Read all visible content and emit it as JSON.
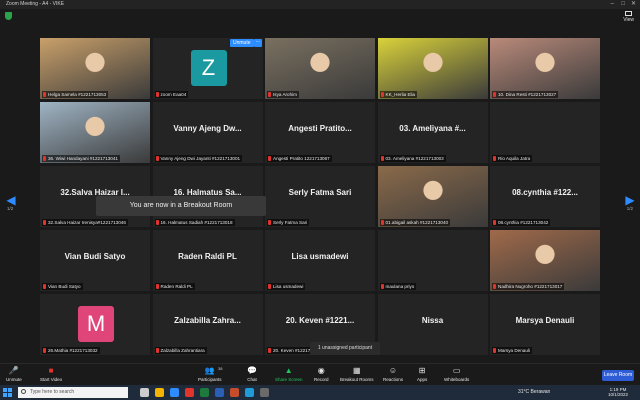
{
  "window": {
    "title": "Zoom Meeting - A4 - VIKE",
    "view_label": "View"
  },
  "breakout_message": "You are now in a Breakout Room",
  "unassigned_text": "1 unassigned participant",
  "unmute_chip": "Unmute",
  "more_chip": "···",
  "page_left": "1/2",
  "page_right": "1/2",
  "tiles": [
    {
      "label": "Helga Samela #1221713053",
      "center": "",
      "kind": "photo",
      "color": "#c9a06a"
    },
    {
      "label": "zoom Eaa04",
      "center": "",
      "kind": "avatar",
      "letter": "Z",
      "color": "#1a9aa0"
    },
    {
      "label": "Isya Arohim",
      "center": "",
      "kind": "photo",
      "color": "#7a7060"
    },
    {
      "label": "KK_Herlia Elia",
      "center": "",
      "kind": "photo",
      "color": "#d9d23a"
    },
    {
      "label": "10. Dina Resti #1221713027",
      "center": "",
      "kind": "photo",
      "color": "#b98a7a"
    },
    {
      "label": "36. Wiwi Handayani #1221713041",
      "center": "",
      "kind": "photo",
      "color": "#9fb4c4"
    },
    {
      "label": "Vanny Ajeng Dwi Jayanti #1221713001",
      "center": "Vanny Ajeng Dw...",
      "kind": "name"
    },
    {
      "label": "Angesti Pratito 1221713067",
      "center": "Angesti Pratito...",
      "kind": "name"
    },
    {
      "label": "03. Ameliyana #1221713003",
      "center": "03. Ameliyana #...",
      "kind": "name"
    },
    {
      "label": "Rio Aquila Jatra",
      "center": "",
      "kind": "empty"
    },
    {
      "label": "32.Salva Haizar Irenisya#1221713046",
      "center": "32.Salva Haizar I...",
      "kind": "name"
    },
    {
      "label": "16. Halmatus Sadiah #1221713018",
      "center": "16. Halmatus Sa...",
      "kind": "name"
    },
    {
      "label": "Serly Fatma Sari",
      "center": "Serly Fatma Sari",
      "kind": "name"
    },
    {
      "label": "01.abigail askah #1221713040",
      "center": "",
      "kind": "photo",
      "color": "#8a6a4a"
    },
    {
      "label": "08.cynthia #1221713042",
      "center": "08.cynthia #122...",
      "kind": "name"
    },
    {
      "label": "Vian Budi Satyo",
      "center": "Vian Budi Satyo",
      "kind": "name"
    },
    {
      "label": "Raden Raldi PL",
      "center": "Raden Raldi PL",
      "kind": "name"
    },
    {
      "label": "Lisa usmadewi",
      "center": "Lisa usmadewi",
      "kind": "name"
    },
    {
      "label": "maulana priyo",
      "center": "",
      "kind": "empty"
    },
    {
      "label": "Nadhira Nugroho #1221713017",
      "center": "",
      "kind": "photo",
      "color": "#a06a4a"
    },
    {
      "label": "26.Mathia #1221713032",
      "center": "",
      "kind": "avatar",
      "letter": "M",
      "color": "#e0457a"
    },
    {
      "label": "Zalzabilla Zahrantiara",
      "center": "Zalzabilla Zahra...",
      "kind": "name"
    },
    {
      "label": "20. Keven #1221713035",
      "center": "20. Keven #1221...",
      "kind": "name"
    },
    {
      "label": "",
      "center": "Nissa",
      "kind": "name"
    },
    {
      "label": "Marsya Denauli",
      "center": "Marsya Denauli",
      "kind": "name"
    }
  ],
  "toolbar": {
    "unmute": "Unmute",
    "start_video": "Start Video",
    "participants": "Participants",
    "participants_count": "38",
    "chat": "Chat",
    "share_screen": "Share Screen",
    "record": "Record",
    "breakout_rooms": "Breakout Rooms",
    "reactions": "Reactions",
    "apps": "Apps",
    "whiteboards": "Whiteboards",
    "leave": "Leave Room"
  },
  "taskbar": {
    "search_placeholder": "Type here to search",
    "weather": "31°C  Berawan",
    "time": "1:19 PM",
    "date": "10/1/2022"
  }
}
